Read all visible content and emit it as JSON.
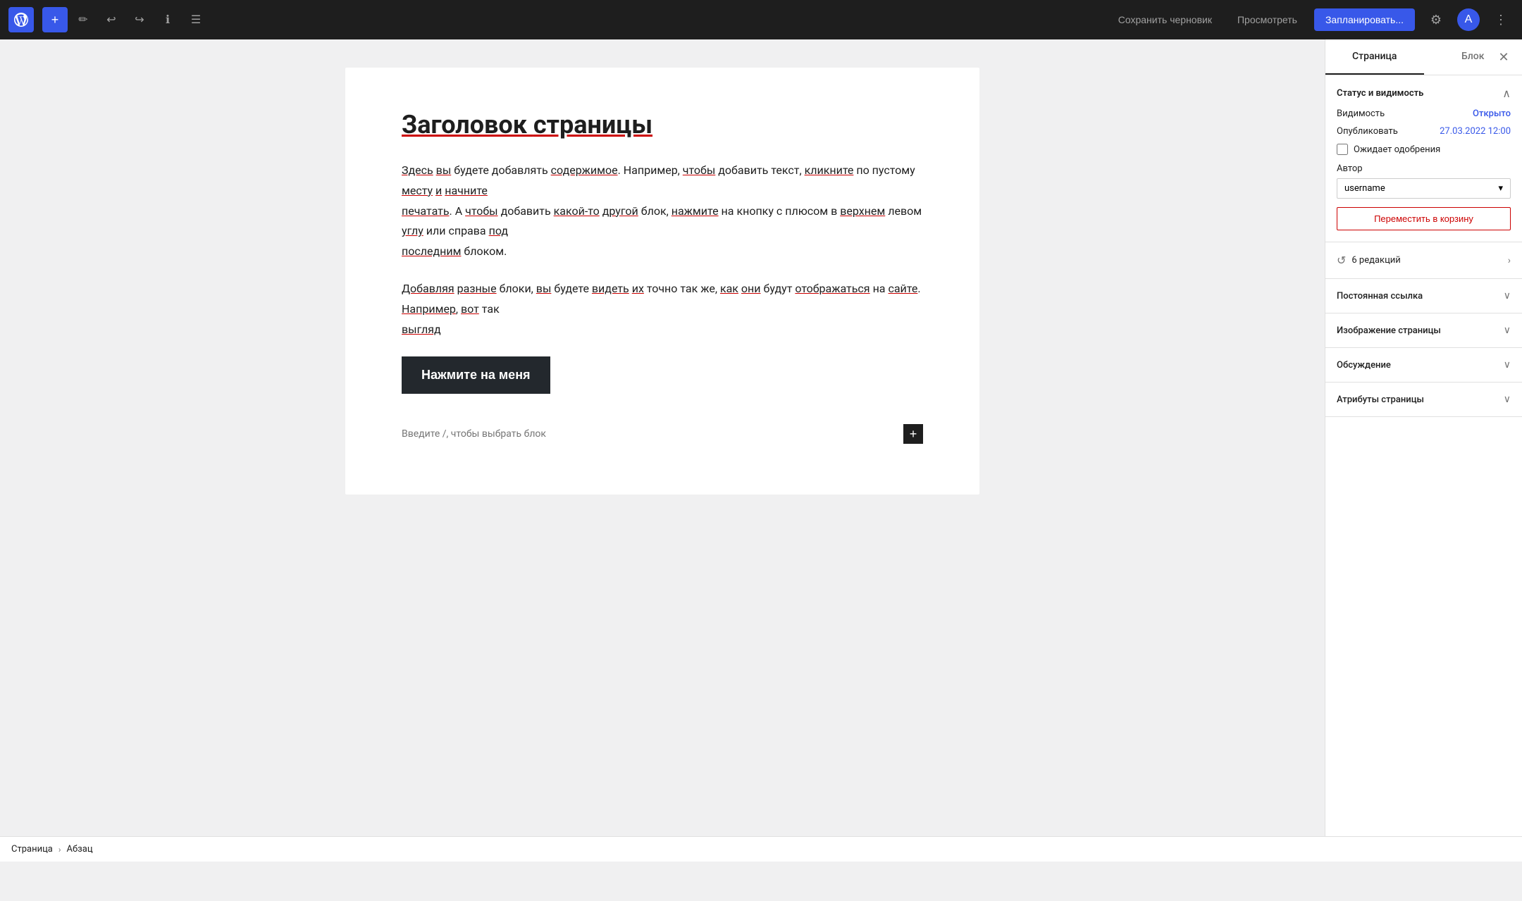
{
  "toolbar": {
    "add_label": "+",
    "save_draft_label": "Сохранить черновик",
    "preview_label": "Просмотреть",
    "schedule_label": "Запланировать...",
    "wp_logo_title": "WordPress"
  },
  "editor": {
    "page_title_prefix": "Заголовок ",
    "page_title_underline": "страницы",
    "paragraph1": "Здесь вы будете добавлять содержимое. Например, чтобы добавить текст, кликните по пустому месту и начните печатать. А чтобы добавить какой-то другой блок, нажмите на кнопку с плюсом в верхнем левом углу или справа под последним блоком.",
    "paragraph2": "Добавляя разные блоки, вы будете видеть их точно так же, как они будут отображаться на сайте. Например, вот так выгляд",
    "cta_button_label": "Нажмите на меня",
    "block_hint": "Введите /, чтобы выбрать блок"
  },
  "sidebar": {
    "tab_page_label": "Страница",
    "tab_block_label": "Блок",
    "status_section_title": "Статус и видимость",
    "visibility_label": "Видимость",
    "visibility_value": "Открыто",
    "publish_label": "Опубликовать",
    "publish_value": "27.03.2022 12:00",
    "awaiting_approval_label": "Ожидает одобрения",
    "author_label": "Автор",
    "author_value": "username",
    "trash_label": "Переместить в корзину",
    "revisions_label": "6 редакций",
    "permalink_label": "Постоянная ссылка",
    "featured_image_label": "Изображение страницы",
    "discussion_label": "Обсуждение",
    "page_attributes_label": "Атрибуты страницы"
  },
  "status_bar": {
    "breadcrumb_page": "Страница",
    "breadcrumb_sep": "›",
    "breadcrumb_block": "Абзац"
  },
  "colors": {
    "accent": "#3858e9",
    "trash_red": "#c00",
    "toolbar_bg": "#1e1e1e"
  }
}
